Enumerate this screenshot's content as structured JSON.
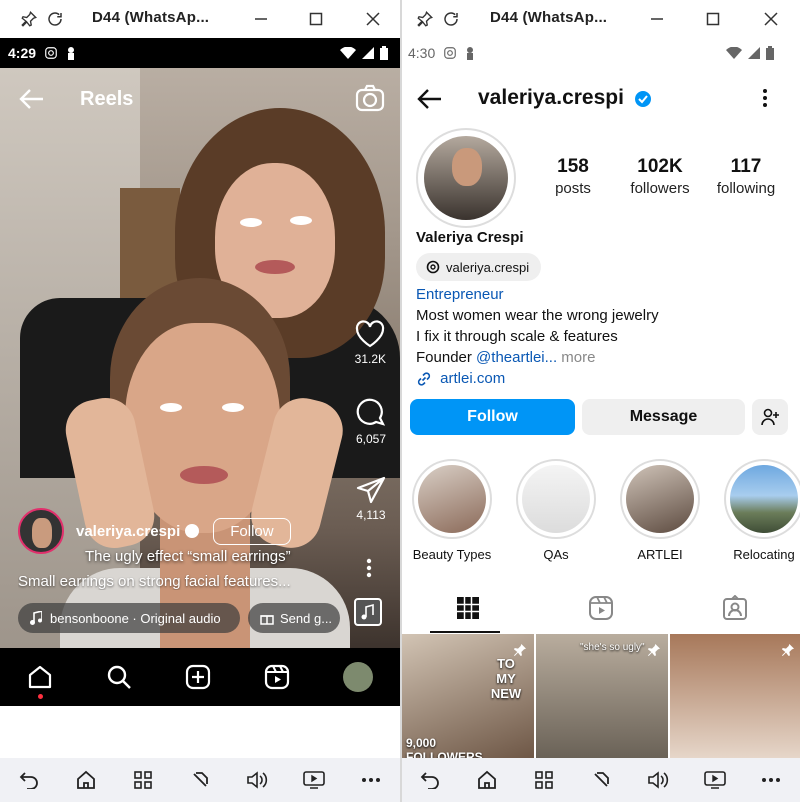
{
  "left": {
    "window_title": "D44  (WhatsAp...",
    "status": {
      "time": "4:29"
    },
    "reels_title": "Reels",
    "actions": {
      "likes": "31.2K",
      "comments": "6,057",
      "shares": "4,113"
    },
    "author": {
      "username": "valeriya.crespi",
      "follow_label": "Follow"
    },
    "overlay_text": "The ugly effect “small earrings”",
    "caption": "Small earrings on strong facial features...",
    "audio": "bensonboone · Original audio",
    "gift": "Send g..."
  },
  "right": {
    "window_title": "D44  (WhatsAp...",
    "status": {
      "time": "4:30"
    },
    "username": "valeriya.crespi",
    "stats": {
      "posts": "158",
      "posts_label": "posts",
      "followers": "102K",
      "followers_label": "followers",
      "following": "117",
      "following_label": "following"
    },
    "full_name": "Valeriya Crespi",
    "threads_handle": "valeriya.crespi",
    "category": "Entrepreneur",
    "bio_line1": "Most women wear the wrong jewelry",
    "bio_line2": "I fix it through scale & features",
    "bio_founder": "Founder ",
    "bio_mention": "@theartlei...",
    "bio_more": " more",
    "link": "artlei.com",
    "follow_label": "Follow",
    "message_label": "Message",
    "highlights": [
      {
        "label": "Beauty Types"
      },
      {
        "label": "QAs"
      },
      {
        "label": "ARTLEI"
      },
      {
        "label": "Relocating"
      }
    ],
    "grid": {
      "cell1_text": "TO MY NEW",
      "cell1_views": "9,000",
      "cell1_bottom": "FOLLOWERS",
      "cell2_text": "\"she's so ugly\""
    }
  },
  "colors": {
    "accent": "#0095f6",
    "link": "#0a58b4"
  }
}
